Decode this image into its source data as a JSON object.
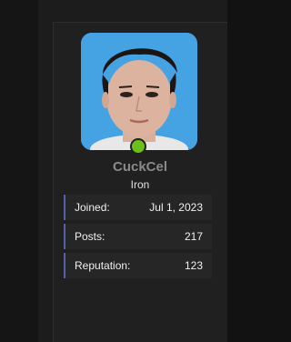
{
  "profile": {
    "username": "CuckCel",
    "rank": "Iron",
    "online_status": "online",
    "status_color": "#6cc01c"
  },
  "stats": [
    {
      "label": "Joined:",
      "value": "Jul 1, 2023"
    },
    {
      "label": "Posts:",
      "value": "217"
    },
    {
      "label": "Reputation:",
      "value": "123"
    }
  ],
  "colors": {
    "accent": "#5562a8",
    "username": "#8a8a8a"
  }
}
